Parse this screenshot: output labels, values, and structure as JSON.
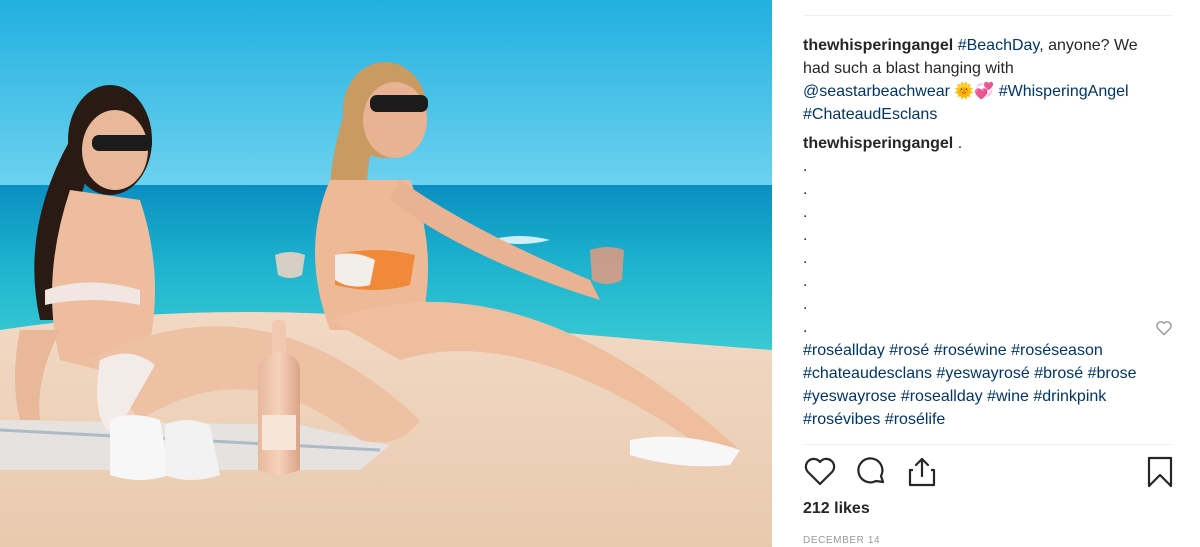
{
  "post": {
    "photo_alt": "",
    "caption": {
      "username": "thewhisperingangel",
      "parts": [
        {
          "text": "#BeachDay",
          "type": "tag"
        },
        {
          "text": ", anyone? We had such a blast hanging with ",
          "type": "text"
        },
        {
          "text": "@seastarbeachwear",
          "type": "tag"
        },
        {
          "text": " 🌞💞 ",
          "type": "text"
        },
        {
          "text": "#WhisperingAngel",
          "type": "tag"
        },
        {
          "text": " ",
          "type": "text"
        },
        {
          "text": "#ChateaudEsclans",
          "type": "tag"
        }
      ]
    },
    "comment": {
      "username": "thewhisperingangel",
      "first_line": ".",
      "dots": [
        ".",
        ".",
        ".",
        ".",
        ".",
        ".",
        ".",
        "."
      ],
      "hashtags": "#roséallday #rosé #roséwine #roséseason #chateaudesclans #yeswayrosé #brosé #brose #yeswayrose #roseallday #wine #drinkpink #rosévibes #rosélife"
    },
    "likes": "212 likes",
    "date": "DECEMBER 14"
  },
  "icons": {
    "comment_like": "heart-outline-icon",
    "like": "heart-icon",
    "comment": "comment-bubble-icon",
    "share": "share-icon",
    "save": "bookmark-icon"
  },
  "colors": {
    "hashtag": "#003569",
    "text": "#262626",
    "muted": "#999999",
    "divider": "#efefef"
  }
}
